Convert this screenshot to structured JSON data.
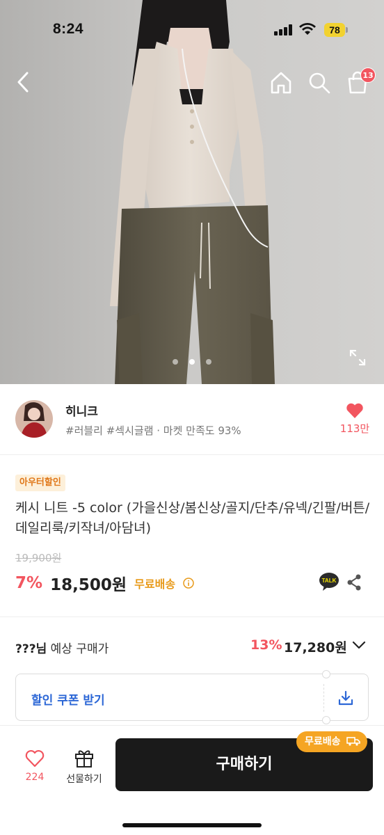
{
  "status_bar": {
    "time": "8:24",
    "battery": "78"
  },
  "nav": {
    "cart_count": "13"
  },
  "carousel": {
    "total": 3,
    "active": 2
  },
  "shop": {
    "name": "히니크",
    "tags": "#러블리 #섹시글램 · 마켓 만족도 93%",
    "like_count": "113만"
  },
  "product": {
    "badge": "아우터할인",
    "title": "케시 니트 -5 color (가을신상/봄신상/골지/단추/유넥/긴팔/버튼/데일리룩/키작녀/아담녀)",
    "original_price": "19,900원",
    "discount": "7%",
    "price": "18,500원",
    "free_shipping": "무료배송"
  },
  "expected": {
    "user": "???님",
    "label": " 예상 구매가",
    "discount": "13%",
    "price": "17,280원"
  },
  "coupon": {
    "label": "할인 쿠폰 받기"
  },
  "bottom": {
    "likes": "224",
    "gift_label": "선물하기",
    "buy_label": "구매하기",
    "ship_tag": "무료배송"
  },
  "colors": {
    "accent_red": "#f2555f",
    "accent_orange": "#e89a1a",
    "coupon_blue": "#2c67d6",
    "buy_bg": "#1a1a1a"
  },
  "icons": [
    "back-icon",
    "home-icon",
    "search-icon",
    "cart-icon",
    "expand-icon",
    "heart-icon",
    "info-icon",
    "kakao-talk-icon",
    "share-icon",
    "chevron-down-icon",
    "download-icon",
    "gift-icon",
    "truck-icon"
  ]
}
